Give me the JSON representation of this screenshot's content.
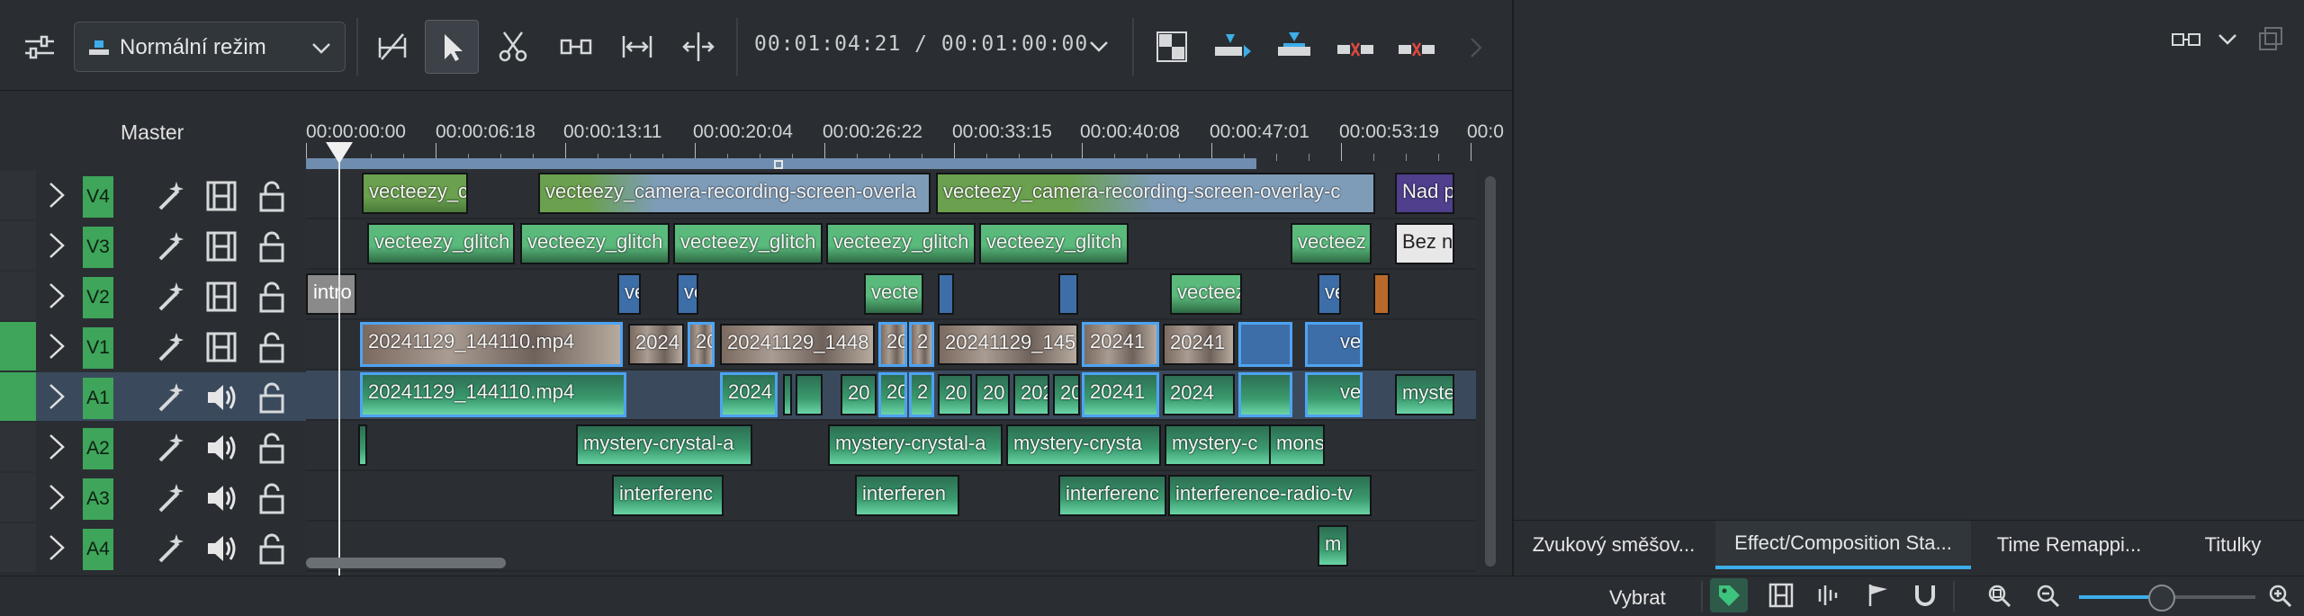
{
  "toolbar": {
    "mode_label": "Normální režim",
    "timecode": "00:01:04:21 / 00:01:00:00"
  },
  "headers": {
    "master_label": "Master",
    "tracks": [
      {
        "name": "V4",
        "kind": "video"
      },
      {
        "name": "V3",
        "kind": "video"
      },
      {
        "name": "V2",
        "kind": "video"
      },
      {
        "name": "V1",
        "kind": "video"
      },
      {
        "name": "A1",
        "kind": "audio"
      },
      {
        "name": "A2",
        "kind": "audio"
      },
      {
        "name": "A3",
        "kind": "audio"
      },
      {
        "name": "A4",
        "kind": "audio"
      }
    ]
  },
  "ruler": {
    "labels": [
      "00:00:00:00",
      "00:00:06:18",
      "00:00:13:11",
      "00:00:20:04",
      "00:00:26:22",
      "00:00:33:15",
      "00:00:40:08",
      "00:00:47:01",
      "00:00:53:19",
      "00:0"
    ]
  },
  "clips": {
    "v4": [
      "vecteezy_camera-",
      "vecteezy_camera-recording-screen-overla",
      "vecteezy_camera-recording-screen-overlay-c",
      "Nad p"
    ],
    "v3": [
      "vecteezy_glitch",
      "vecteezy_glitch",
      "vecteezy_glitch",
      "vecteezy_glitch",
      "vecteezy_glitch",
      "vecteez",
      "Bez n"
    ],
    "v2": [
      "intro",
      "ve",
      "ve",
      "vecte",
      "vecteez",
      "ve"
    ],
    "v1": [
      "20241129_144110.mp4",
      "2024",
      "20",
      "20241129_1448",
      "20",
      "2",
      "20241129_145",
      "20241",
      "20241",
      "ve"
    ],
    "a1": [
      "20241129_144110.mp4",
      "2024",
      "20",
      "20",
      "2",
      "20",
      "20",
      "202",
      "20",
      "20241",
      "2024",
      "ve",
      "myste"
    ],
    "a2": [
      "mystery-crystal-a",
      "mystery-crystal-a",
      "mystery-crysta",
      "mystery-c",
      "mons"
    ],
    "a3": [
      "interferenc",
      "interferen",
      "interferenc",
      "interference-radio-tv"
    ],
    "a4": [
      "m"
    ]
  },
  "tabs": [
    "Zvukový směšov...",
    "Effect/Composition Sta...",
    "Time Remappi...",
    "Titulky"
  ],
  "statusbar": {
    "select_label": "Vybrat"
  },
  "zoom": {
    "level": 0.47
  },
  "colors": {
    "accent": "#3daee9",
    "track_green": "#3ea55a",
    "video_clip": "#6aa04e",
    "audio_clip": "#3a9b6e"
  }
}
